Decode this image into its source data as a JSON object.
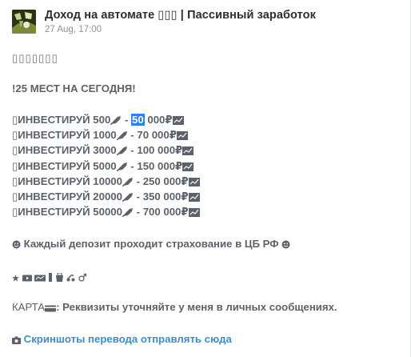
{
  "post": {
    "channel_title": "Доход на автомате ▯▯▯ | Пассивный заработок",
    "date": "27 Aug, 17:00",
    "decor_squares": "▯▯▯▯▯▯▯",
    "headline_mark": "!",
    "headline_text": "25 МЕСТ НА СЕГОДНЯ",
    "offers": [
      {
        "prefix": "▯",
        "text": "ИНВЕСТИРУЙ 500",
        "sep": " - ",
        "hl": "50",
        "rest": " 000₽"
      },
      {
        "prefix": "▯",
        "text": "ИНВЕСТИРУЙ 1000",
        "sep": " - ",
        "hl": "",
        "rest": "70 000₽"
      },
      {
        "prefix": "▯",
        "text": "ИНВЕСТИРУЙ 3000",
        "sep": " - ",
        "hl": "",
        "rest": "100 000₽"
      },
      {
        "prefix": "▯",
        "text": "ИНВЕСТИРУЙ 5000",
        "sep": " - ",
        "hl": "",
        "rest": "150 000₽"
      },
      {
        "prefix": "▯",
        "text": "ИНВЕСТИРУЙ 10000",
        "sep": " - ",
        "hl": "",
        "rest": "250 000₽"
      },
      {
        "prefix": "▯",
        "text": "ИНВЕСТИРУЙ 20000",
        "sep": " - ",
        "hl": "",
        "rest": "350 000₽"
      },
      {
        "prefix": "▯",
        "text": "ИНВЕСТИРУЙ 50000",
        "sep": " - ",
        "hl": "",
        "rest": "700 000₽"
      }
    ],
    "insurance_text": "Каждый депозит проходит страхование в ЦБ РФ",
    "card_label": "КАРТА",
    "card_text": ": Реквизиты уточняйте у меня в личных сообщениях.",
    "screenshot_link": "Скриншоты перевода отправлять сюда"
  }
}
